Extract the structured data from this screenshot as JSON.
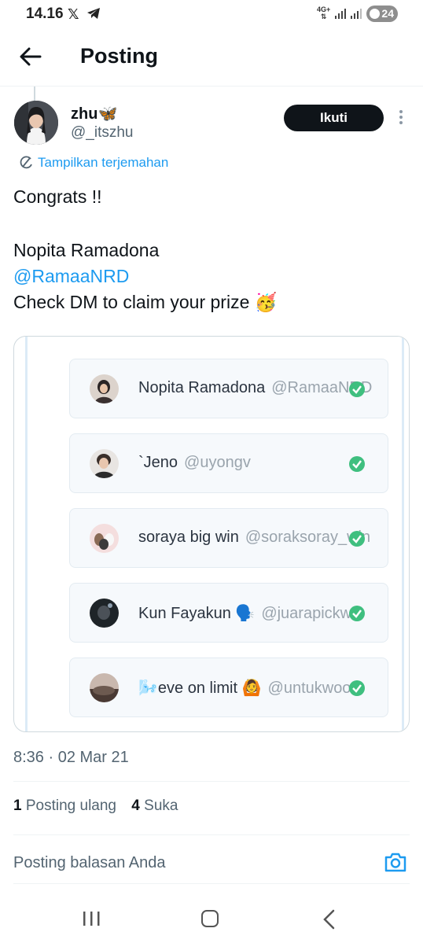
{
  "status_bar": {
    "time": "14.16",
    "x_app": "𝕏",
    "network_type": "4G+",
    "battery": "24",
    "icons": [
      "x-logo-icon",
      "telegram-icon",
      "signal-icon",
      "battery-icon"
    ]
  },
  "header": {
    "title": "Posting",
    "back_icon": "arrow-left-icon"
  },
  "author": {
    "name": "zhu",
    "name_emoji": "🦋",
    "handle": "@_itszhu",
    "follow_label": "Ikuti",
    "more_icon": "more-vertical-icon"
  },
  "translate": {
    "label": "Tampilkan terjemahan",
    "icon": "translate-icon"
  },
  "tweet": {
    "line1": "Congrats !!",
    "line2": "Nopita Ramadona",
    "mention": "@RamaaNRD",
    "line4": "Check DM to claim your prize 🥳"
  },
  "media": {
    "entries": [
      {
        "name": "Nopita Ramadona",
        "handle": "@RamaaNRD"
      },
      {
        "name": "`Jeno",
        "handle": "@uyongv"
      },
      {
        "name": "soraya big win",
        "handle": "@soraksoray_win"
      },
      {
        "name": "Kun Fayakun 🗣️",
        "handle": "@juarapickww"
      },
      {
        "name": "🌬️eve on limit 🙆",
        "handle": "@untukwoo"
      }
    ],
    "check_icon": "green-check-icon"
  },
  "timestamp": "8:36 · 02 Mar 21",
  "stats": {
    "reposts_count": "1",
    "reposts_label": "Posting ulang",
    "likes_count": "4",
    "likes_label": "Suka"
  },
  "reply": {
    "placeholder": "Posting balasan Anda",
    "camera_icon": "camera-icon"
  },
  "nav": {
    "icons": [
      "recents-icon",
      "home-icon",
      "back-icon"
    ]
  },
  "colors": {
    "accent": "#1d9bf0",
    "text": "#0f1419",
    "muted": "#536471",
    "check": "#3fbf7f"
  }
}
